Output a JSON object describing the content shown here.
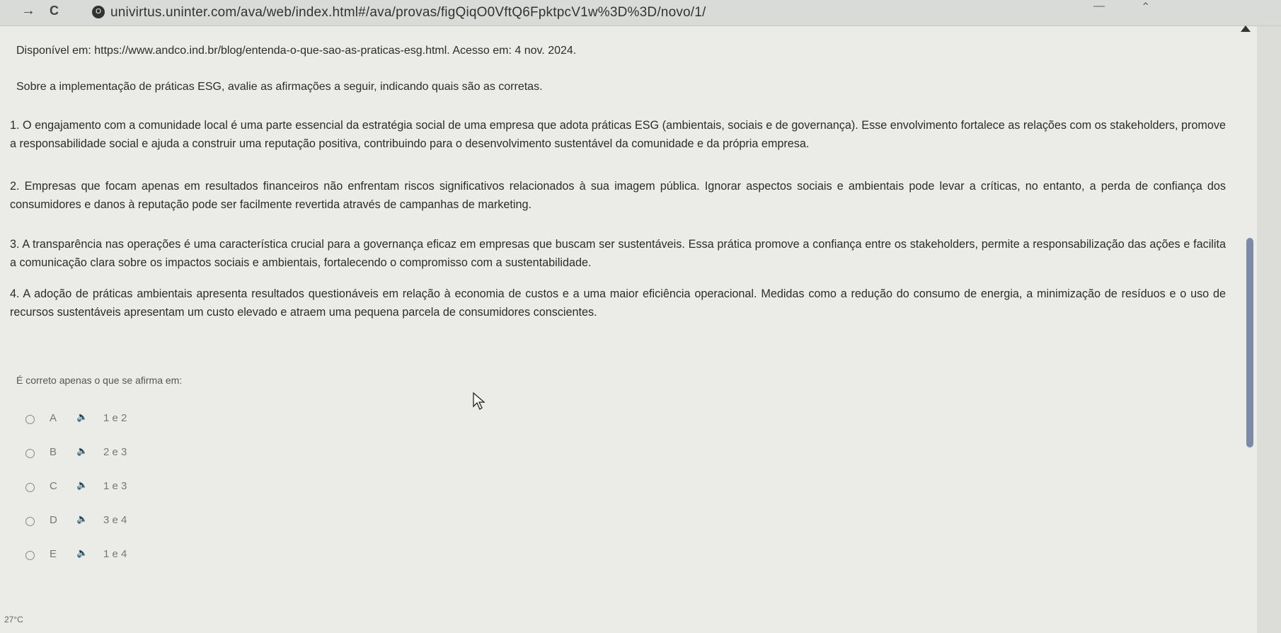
{
  "browser": {
    "back": "→",
    "reload": "C",
    "url": "univirtus.uninter.com/ava/web/index.html#/ava/provas/figQiqO0VftQ6FpktpcV1w%3D%3D/novo/1/"
  },
  "question": {
    "source": "Disponível em: https://www.andco.ind.br/blog/entenda-o-que-sao-as-praticas-esg.html. Acesso em: 4 nov. 2024.",
    "prompt": "Sobre a implementação de práticas ESG, avalie as afirmações a seguir, indicando quais são as corretas.",
    "statements": [
      "1. O engajamento com a comunidade local é uma parte essencial da estratégia social de uma empresa que adota práticas ESG (ambientais, sociais e de governança). Esse envolvimento fortalece as relações com os stakeholders, promove a responsabilidade social e ajuda a construir uma reputação positiva, contribuindo para o desenvolvimento sustentável da comunidade e da própria empresa.",
      "2. Empresas que focam apenas em resultados financeiros não enfrentam riscos significativos relacionados à sua imagem pública. Ignorar aspectos sociais e ambientais pode levar a críticas, no entanto, a perda de confiança dos consumidores e danos à reputação pode ser facilmente revertida através de campanhas de marketing.",
      "3. A transparência nas operações é uma característica crucial para a governança eficaz em empresas que buscam ser sustentáveis. Essa prática promove a confiança entre os stakeholders, permite a responsabilização das ações e facilita a comunicação clara sobre os impactos sociais e ambientais, fortalecendo o compromisso com a sustentabilidade.",
      "4. A adoção de práticas ambientais apresenta resultados questionáveis em relação à economia de custos e a uma maior eficiência operacional. Medidas como a redução do consumo de energia, a minimização de resíduos e o uso de recursos sustentáveis apresentam um custo elevado e atraem uma pequena parcela de consumidores conscientes."
    ],
    "question_text": "É correto apenas o que se afirma em:"
  },
  "options": [
    {
      "letter": "A",
      "text": "1 e 2"
    },
    {
      "letter": "B",
      "text": "2 e 3"
    },
    {
      "letter": "C",
      "text": "1 e 3"
    },
    {
      "letter": "D",
      "text": "3 e 4"
    },
    {
      "letter": "E",
      "text": "1 e 4"
    }
  ],
  "icons": {
    "speaker": "🔈",
    "site_badge": "O"
  },
  "taskbar": {
    "temperature": "27°C"
  }
}
